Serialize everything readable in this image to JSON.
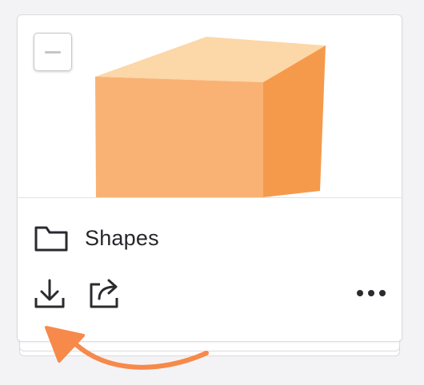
{
  "item": {
    "title": "Shapes",
    "thumbnail_icon": "orange-box-3d",
    "folder_icon": "folder-icon"
  },
  "actions": {
    "collapse_icon": "minus-icon",
    "download_icon": "download-icon",
    "share_icon": "share-icon",
    "more_icon": "more-horizontal-icon"
  },
  "annotation": {
    "arrow_icon": "curved-arrow-icon",
    "arrow_color": "#f7894a"
  },
  "colors": {
    "box_front": "#f9b274",
    "box_side": "#f59a4b",
    "box_top": "#fcd7a8",
    "text": "#26262b"
  }
}
